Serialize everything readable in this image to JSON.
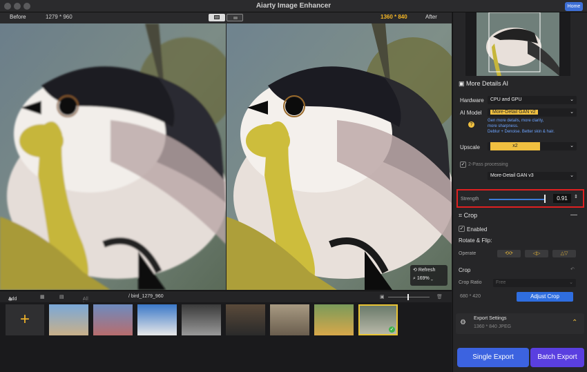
{
  "window": {
    "title": "Aiarty Image Enhancer",
    "home_label": "Home"
  },
  "compare": {
    "before_label": "Before",
    "before_size": "1279 * 960",
    "after_size": "1360 * 840",
    "after_label": "After"
  },
  "zoom": {
    "refresh_label": "Refresh",
    "zoom_value": "169%"
  },
  "filmbar": {
    "add_label": "Add",
    "all_images_label": "All Images (8)",
    "file_path": "/ bird_1279_960"
  },
  "sidebar": {
    "section_title": "More Details AI",
    "hardware_label": "Hardware",
    "hardware_value": "CPU and GPU",
    "ai_model_label": "AI Model",
    "ai_model_value": "More-Detail GAN  v2",
    "ai_model_hint_1": "Gen more details, more clarity,",
    "ai_model_hint_2": "more sharpness.",
    "ai_model_hint_3": "Deblur + Denoise. Better skin & hair.",
    "upscale_label": "Upscale",
    "upscale_value": "x2",
    "two_pass_label": "2-Pass processing",
    "second_model_value": "More-Detail GAN  v3",
    "strength_label": "Strength",
    "strength_value": "0.91",
    "crop_title": "Crop",
    "enabled_label": "Enabled",
    "rotate_flip_label": "Rotate & Flip:",
    "operate_label": "Operate",
    "crop_sub_label": "Crop",
    "crop_ratio_label": "Crop Ratio",
    "crop_ratio_value": "Free",
    "crop_size": "680 *  420",
    "adjust_crop_label": "Adjust Crop",
    "export_title": "Export Settings",
    "export_detail": "1360 * 840  JPEG",
    "single_export_label": "Single Export",
    "batch_export_label": "Batch Export"
  },
  "colors": {
    "accent_yellow": "#f0c040",
    "accent_blue": "#2f6ee0",
    "highlight_red": "#e02020"
  }
}
